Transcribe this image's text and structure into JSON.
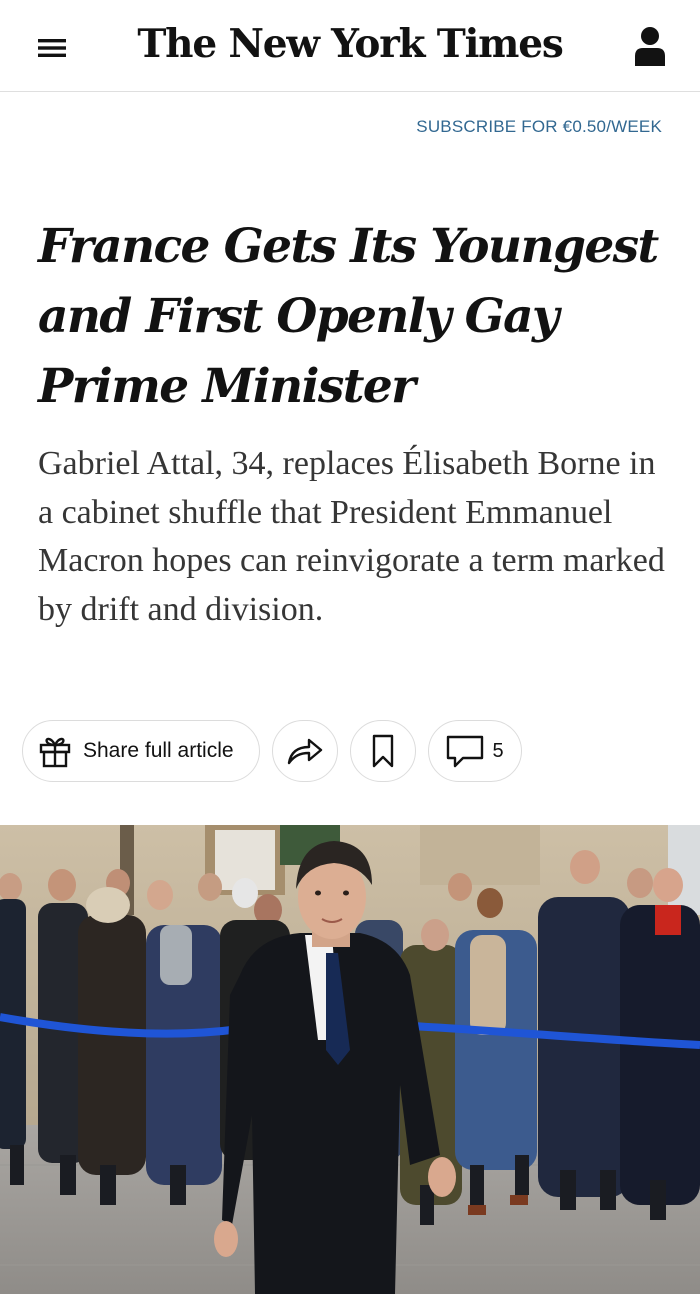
{
  "header": {
    "menu_icon": "hamburger-menu-icon",
    "masthead": "The New York Times",
    "account_icon": "person-icon"
  },
  "subscribe": {
    "label": "SUBSCRIBE FOR €0.50/WEEK"
  },
  "article": {
    "headline": "France Gets Its Youngest and First Openly Gay Prime Minister",
    "summary": "Gabriel Attal, 34, replaces Élisabeth Borne in a cabinet shuffle that President Emmanuel Macron hopes can reinvigorate a term marked by drift and division."
  },
  "toolbar": {
    "share_label": "Share full article",
    "share_icon": "gift-icon",
    "forward_icon": "forward-arrow-icon",
    "bookmark_icon": "bookmark-icon",
    "comment_icon": "comment-bubble-icon",
    "comment_count": "5"
  },
  "colors": {
    "link": "#326891",
    "text": "#121212",
    "summary_text": "#363636",
    "border": "#dcdcdc",
    "rope_blue": "#1f55d6"
  }
}
